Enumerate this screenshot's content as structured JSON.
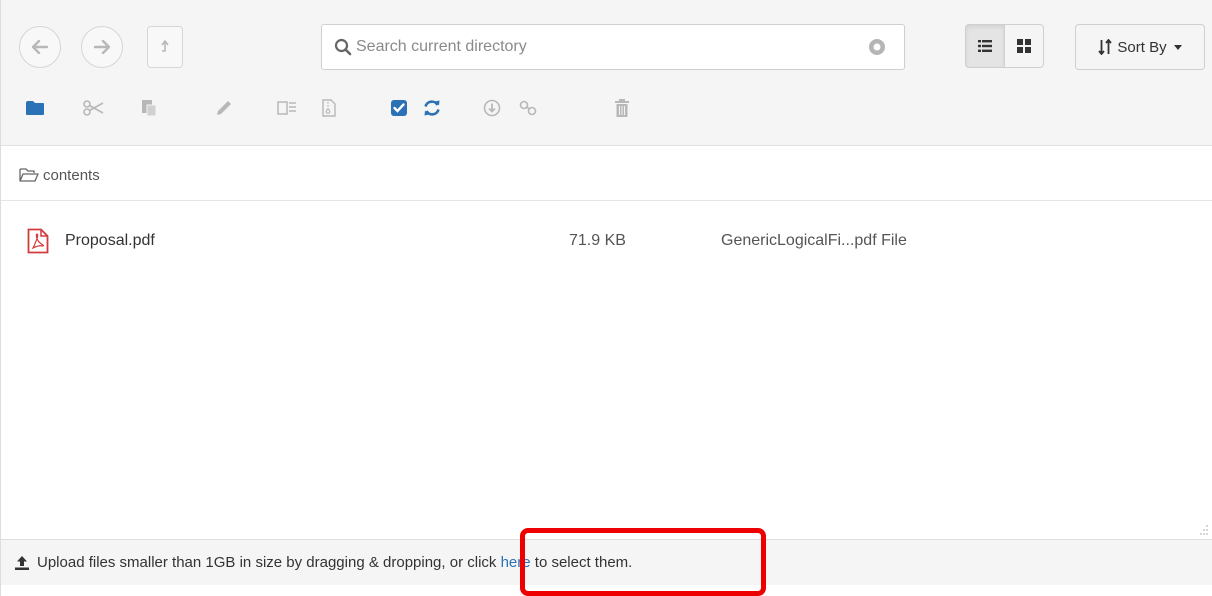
{
  "toolbar": {
    "search": {
      "placeholder": "Search current directory",
      "value": ""
    },
    "sort": {
      "label": "Sort By"
    },
    "view_mode": "list",
    "actions": [
      "new-folder",
      "cut",
      "paste",
      "rename",
      "extract",
      "compress",
      "select-all",
      "refresh",
      "download",
      "share-link",
      "delete"
    ]
  },
  "breadcrumb": {
    "folder": "contents"
  },
  "files": [
    {
      "name": "Proposal.pdf",
      "size": "71.9 KB",
      "type": "GenericLogicalFi...pdf File",
      "icon": "pdf-icon"
    }
  ],
  "upload": {
    "text_before": "Upload files smaller than 1GB in size by dragging & dropping, or click ",
    "link_text": "here",
    "text_after": " to select them."
  },
  "colors": {
    "accent_blue": "#2a72b5",
    "pdf_red": "#d33c3c",
    "highlight_red": "#ee0000"
  }
}
